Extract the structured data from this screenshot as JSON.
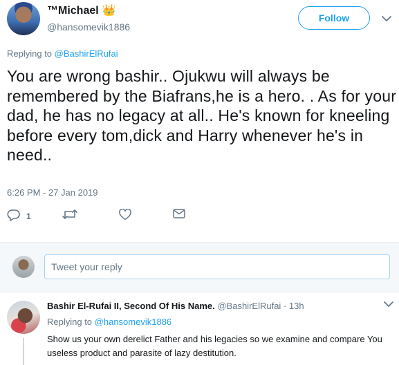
{
  "main_tweet": {
    "display_name": "™Michael",
    "crown_emoji": "👑",
    "handle": "@hansomevik1886",
    "follow_label": "Follow",
    "replying_prefix": "Replying to ",
    "replying_to": "@BashirElRufai",
    "text": "You are wrong bashir.. Ojukwu will always be remembered by the Biafrans,he is a hero. . As for your dad, he has no legacy at all.. He's known for kneeling before every tom,dick and Harry whenever he's in need..",
    "timestamp": "6:26 PM - 27 Jan 2019",
    "actions": {
      "reply_count": "1",
      "retweet_count": "",
      "like_count": ""
    }
  },
  "compose": {
    "placeholder": "Tweet your reply"
  },
  "reply_tweet": {
    "display_name": "Bashir El-Rufai II, Second Of His Name.",
    "handle": "@BashirElRufai",
    "separator": " · ",
    "time": "13h",
    "replying_prefix": "Replying to ",
    "replying_to": "@hansomevik1886",
    "text": "Show us your own derelict Father and his legacies so we examine and compare You useless product and parasite of lazy destitution."
  },
  "colors": {
    "accent": "#1da1f2",
    "muted": "#657786",
    "text": "#14171a",
    "divider": "#e6ecf0",
    "compose_bg": "#f5f8fa"
  },
  "icons": [
    "chevron-down-icon",
    "reply-icon",
    "retweet-icon",
    "like-icon",
    "direct-message-icon"
  ]
}
